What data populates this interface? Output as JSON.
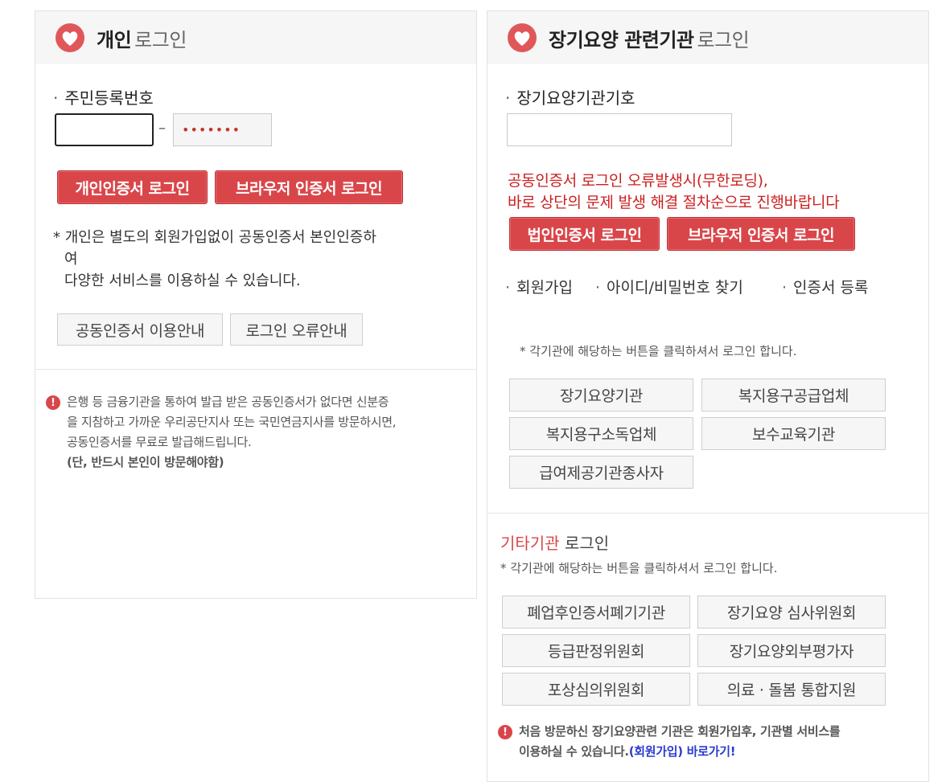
{
  "personal": {
    "title": "개인",
    "title_sub": "로그인",
    "resident_label": "주민등록번호",
    "resident_first_value": "",
    "resident_dash": "–",
    "resident_second_value": "•••••••",
    "cert_login": "개인인증서 로그인",
    "browser_cert_login": "브라우저 인증서 로그인",
    "notice_line1": "* 개인은 별도의 회원가입없이 공동인증서 본인인증하",
    "notice_line2": "여",
    "notice_line3": "다양한 서비스를 이용하실 수 있습니다.",
    "guide_button": "공동인증서 이용안내",
    "error_guide_button": "로그인 오류안내",
    "info_line1": "은행 등 금융기관을 통하여 발급 받은 공동인증서가 없다면 신분증",
    "info_line2": "을 지참하고 가까운 우리공단지사 또는 국민연금지사를 방문하시면,",
    "info_line3": "공동인증서를 무료로 발급해드립니다.",
    "info_line4": "(단, 반드시 본인이 방문해야함)"
  },
  "institution": {
    "title": "장기요양 관련기관",
    "title_sub": "로그인",
    "code_label": "장기요양기관기호",
    "code_value": "",
    "error_line1": "공동인증서 로그인 오류발생시(무한로딩),",
    "error_line2": "바로 상단의 문제 발생 해결 절차순으로 진행바랍니다",
    "corp_cert_login": "법인인증서 로그인",
    "browser_cert_login": "브라우저 인증서 로그인",
    "links": [
      "회원가입",
      "아이디/비밀번호 찾기",
      "인증서 등록"
    ],
    "hint": "* 각기관에 해당하는 버튼을 클릭하셔서 로그인 합니다.",
    "buttons": [
      "장기요양기관",
      "복지용구공급업체",
      "복지용구소독업체",
      "보수교육기관",
      "급여제공기관종사자"
    ],
    "other_title": "기타기관",
    "other_title_sub": "로그인",
    "other_hint": "* 각기관에 해당하는 버튼을 클릭하셔서 로그인 합니다.",
    "other_buttons": [
      "폐업후인증서폐기기관",
      "장기요양 심사위원회",
      "등급판정위원회",
      "장기요양외부평가자",
      "포상심의위원회",
      "의료 · 돌봄 통합지원"
    ],
    "footer_line1": "처음 방문하신 장기요양관련 기관은 회원가입후, 기관별 서비스를",
    "footer_line2": "이용하실 수 있습니다.",
    "footer_link": "(회원가입) 바로가기!"
  },
  "colors": {
    "accent_red": "#d9464a",
    "error_text": "#cc1f1f",
    "link_blue": "#2b3ccf"
  }
}
